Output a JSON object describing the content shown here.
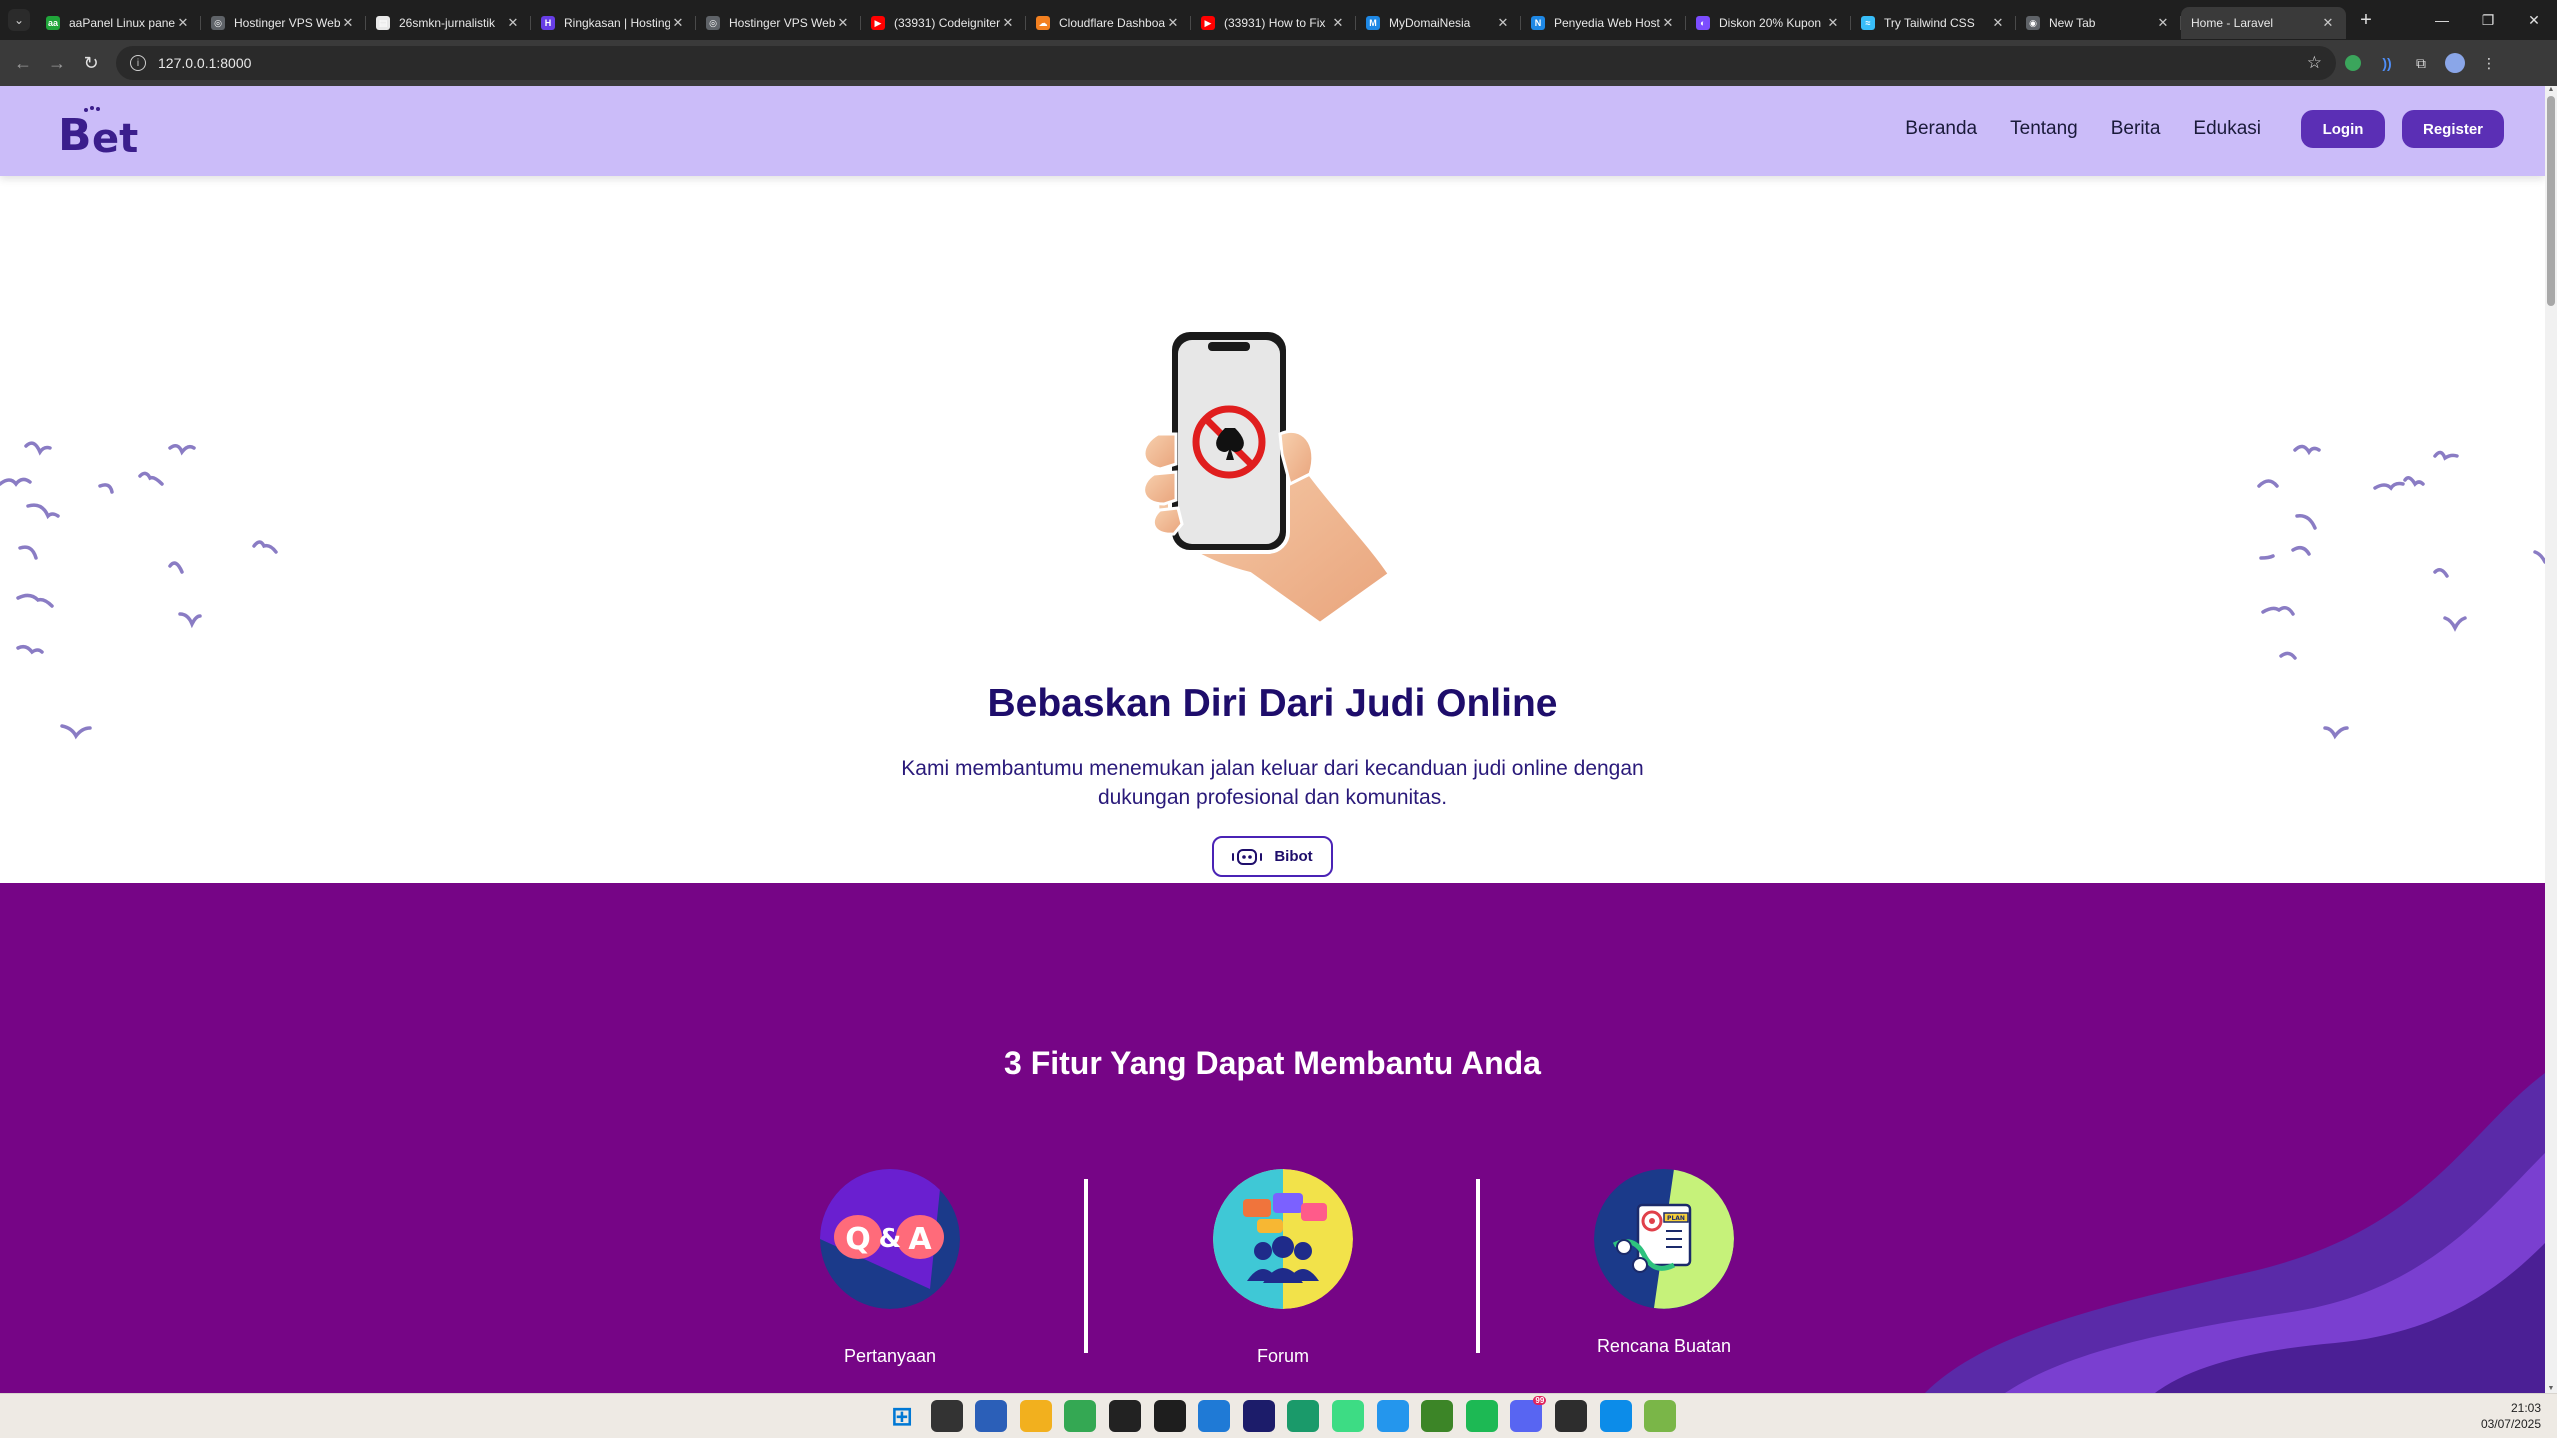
{
  "browser": {
    "tabs": [
      {
        "title": "aaPanel Linux panel",
        "favicon": "aapanel-icon",
        "color": "#20a53a",
        "glyph": "aa"
      },
      {
        "title": "Hostinger VPS Web",
        "favicon": "globe-icon",
        "color": "#5f6368",
        "glyph": "◎"
      },
      {
        "title": "26smkn-jurnalistik",
        "favicon": "page-icon",
        "color": "#e8e8e8",
        "glyph": "▤"
      },
      {
        "title": "Ringkasan | Hostinger",
        "favicon": "hostinger-icon",
        "color": "#673de6",
        "glyph": "H"
      },
      {
        "title": "Hostinger VPS Web",
        "favicon": "globe-icon",
        "color": "#5f6368",
        "glyph": "◎"
      },
      {
        "title": "(33931) Codeigniter",
        "favicon": "youtube-icon",
        "color": "#ff0000",
        "glyph": "▶"
      },
      {
        "title": "Cloudflare Dashboard",
        "favicon": "cloudflare-icon",
        "color": "#f38020",
        "glyph": "☁"
      },
      {
        "title": "(33931) How to Fix",
        "favicon": "youtube-icon",
        "color": "#ff0000",
        "glyph": "▶"
      },
      {
        "title": "MyDomaiNesia",
        "favicon": "mydomainesia-icon",
        "color": "#1e88e5",
        "glyph": "M"
      },
      {
        "title": "Penyedia Web Hosting",
        "favicon": "niagahoster-icon",
        "color": "#1e88e5",
        "glyph": "N"
      },
      {
        "title": "Diskon 20% Kupon",
        "favicon": "discount-icon",
        "color": "#7c4dff",
        "glyph": "◐"
      },
      {
        "title": "Try Tailwind CSS",
        "favicon": "tailwind-icon",
        "color": "#38bdf8",
        "glyph": "≈"
      },
      {
        "title": "New Tab",
        "favicon": "chrome-icon",
        "color": "#5f6368",
        "glyph": "◉"
      },
      {
        "title": "Home - Laravel",
        "favicon": "none",
        "color": "",
        "glyph": ""
      }
    ],
    "active_tab_index": 13,
    "new_tab": "+",
    "url": "127.0.0.1:8000"
  },
  "site": {
    "logo_alt": "Bet",
    "nav": {
      "links": [
        "Beranda",
        "Tentang",
        "Berita",
        "Edukasi"
      ],
      "login": "Login",
      "register": "Register"
    },
    "hero": {
      "title": "Bebaskan Diri Dari Judi Online",
      "subtitle": "Kami membantumu menemukan jalan keluar dari kecanduan judi online dengan dukungan profesional dan komunitas.",
      "button": "Bibot"
    },
    "features": {
      "title": "3 Fitur Yang Dapat Membantu Anda",
      "items": [
        {
          "label": "Pertanyaan",
          "icon": "qa-icon"
        },
        {
          "label": "Forum",
          "icon": "forum-icon"
        },
        {
          "label": "Rencana Buatan",
          "icon": "plan-icon"
        }
      ]
    },
    "colors": {
      "nav_bg": "#cbbcf9",
      "accent": "#5b2fb5",
      "features_bg": "#760586",
      "title_color": "#1e0d6b"
    }
  },
  "taskbar": {
    "icons": [
      "windows-start-icon",
      "file-explorer-icon",
      "microsoft-store-icon",
      "folder-icon",
      "chrome-icon",
      "github-icon",
      "figma-icon",
      "vscode-icon",
      "jetbrains-icon",
      "pycharm-icon",
      "android-studio-icon",
      "docker-icon",
      "minecraft-icon",
      "spotify-icon",
      "discord-icon",
      "terminal-icon",
      "edge-icon",
      "xampp-icon"
    ],
    "discord_badge": "99",
    "time": "21:03",
    "date": "03/07/2025"
  }
}
